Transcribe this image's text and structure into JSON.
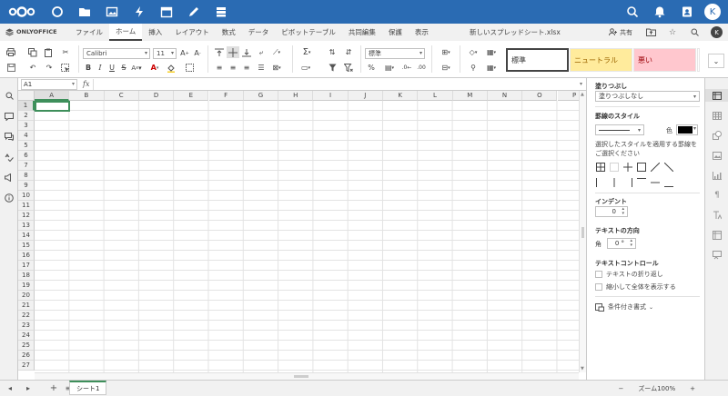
{
  "nextcloud": {
    "apps": [
      "dashboard-icon",
      "files-icon",
      "photos-icon",
      "activity-icon",
      "calendar-icon",
      "notes-icon",
      "deck-icon"
    ],
    "avatar": "K"
  },
  "menu": {
    "brand": "ONLYOFFICE",
    "tabs": [
      "ファイル",
      "ホーム",
      "挿入",
      "レイアウト",
      "数式",
      "データ",
      "ピボットテーブル",
      "共同編集",
      "保護",
      "表示"
    ],
    "active_tab": "ホーム",
    "doc_title": "新しいスプレッドシート.xlsx",
    "share": "共有",
    "user_initial": "K"
  },
  "toolbar": {
    "font_name": "Calibri",
    "font_size": "11",
    "number_format": "標準",
    "styles": [
      "標準",
      "ニュートラル",
      "悪い"
    ]
  },
  "formula_bar": {
    "name_box": "A1",
    "fx": "fx",
    "value": ""
  },
  "grid": {
    "columns": [
      "A",
      "B",
      "C",
      "D",
      "E",
      "F",
      "G",
      "H",
      "I",
      "J",
      "K",
      "L",
      "M",
      "N",
      "O",
      "P"
    ],
    "rows": [
      "1",
      "2",
      "3",
      "4",
      "5",
      "6",
      "7",
      "8",
      "9",
      "10",
      "11",
      "12",
      "13",
      "14",
      "15",
      "16",
      "17",
      "18",
      "19",
      "20",
      "21",
      "22",
      "23",
      "24",
      "25",
      "26",
      "27"
    ],
    "active_cell": "A1"
  },
  "panel": {
    "fill_title": "塗りつぶし",
    "fill_value": "塗りつぶしなし",
    "border_title": "罫線のスタイル",
    "color_label": "色",
    "border_hint": "選択したスタイルを適用する罫線をご選択ください",
    "indent_title": "インデント",
    "indent_value": "0",
    "direction_title": "テキストの方向",
    "angle_label": "角",
    "angle_value": "0 °",
    "text_control_title": "テキストコントロール",
    "wrap_label": "テキストの折り返し",
    "shrink_label": "縮小して全体を表示する",
    "conditional_label": "条件付き書式"
  },
  "status": {
    "sheet": "シート1",
    "zoom": "ズーム100%"
  },
  "colors": {
    "nextcloud_blue": "#2a6bb3",
    "accent_green": "#3e8f5b",
    "neutral_fill": "#ffeb9c",
    "bad_fill": "#ffc7ce"
  }
}
